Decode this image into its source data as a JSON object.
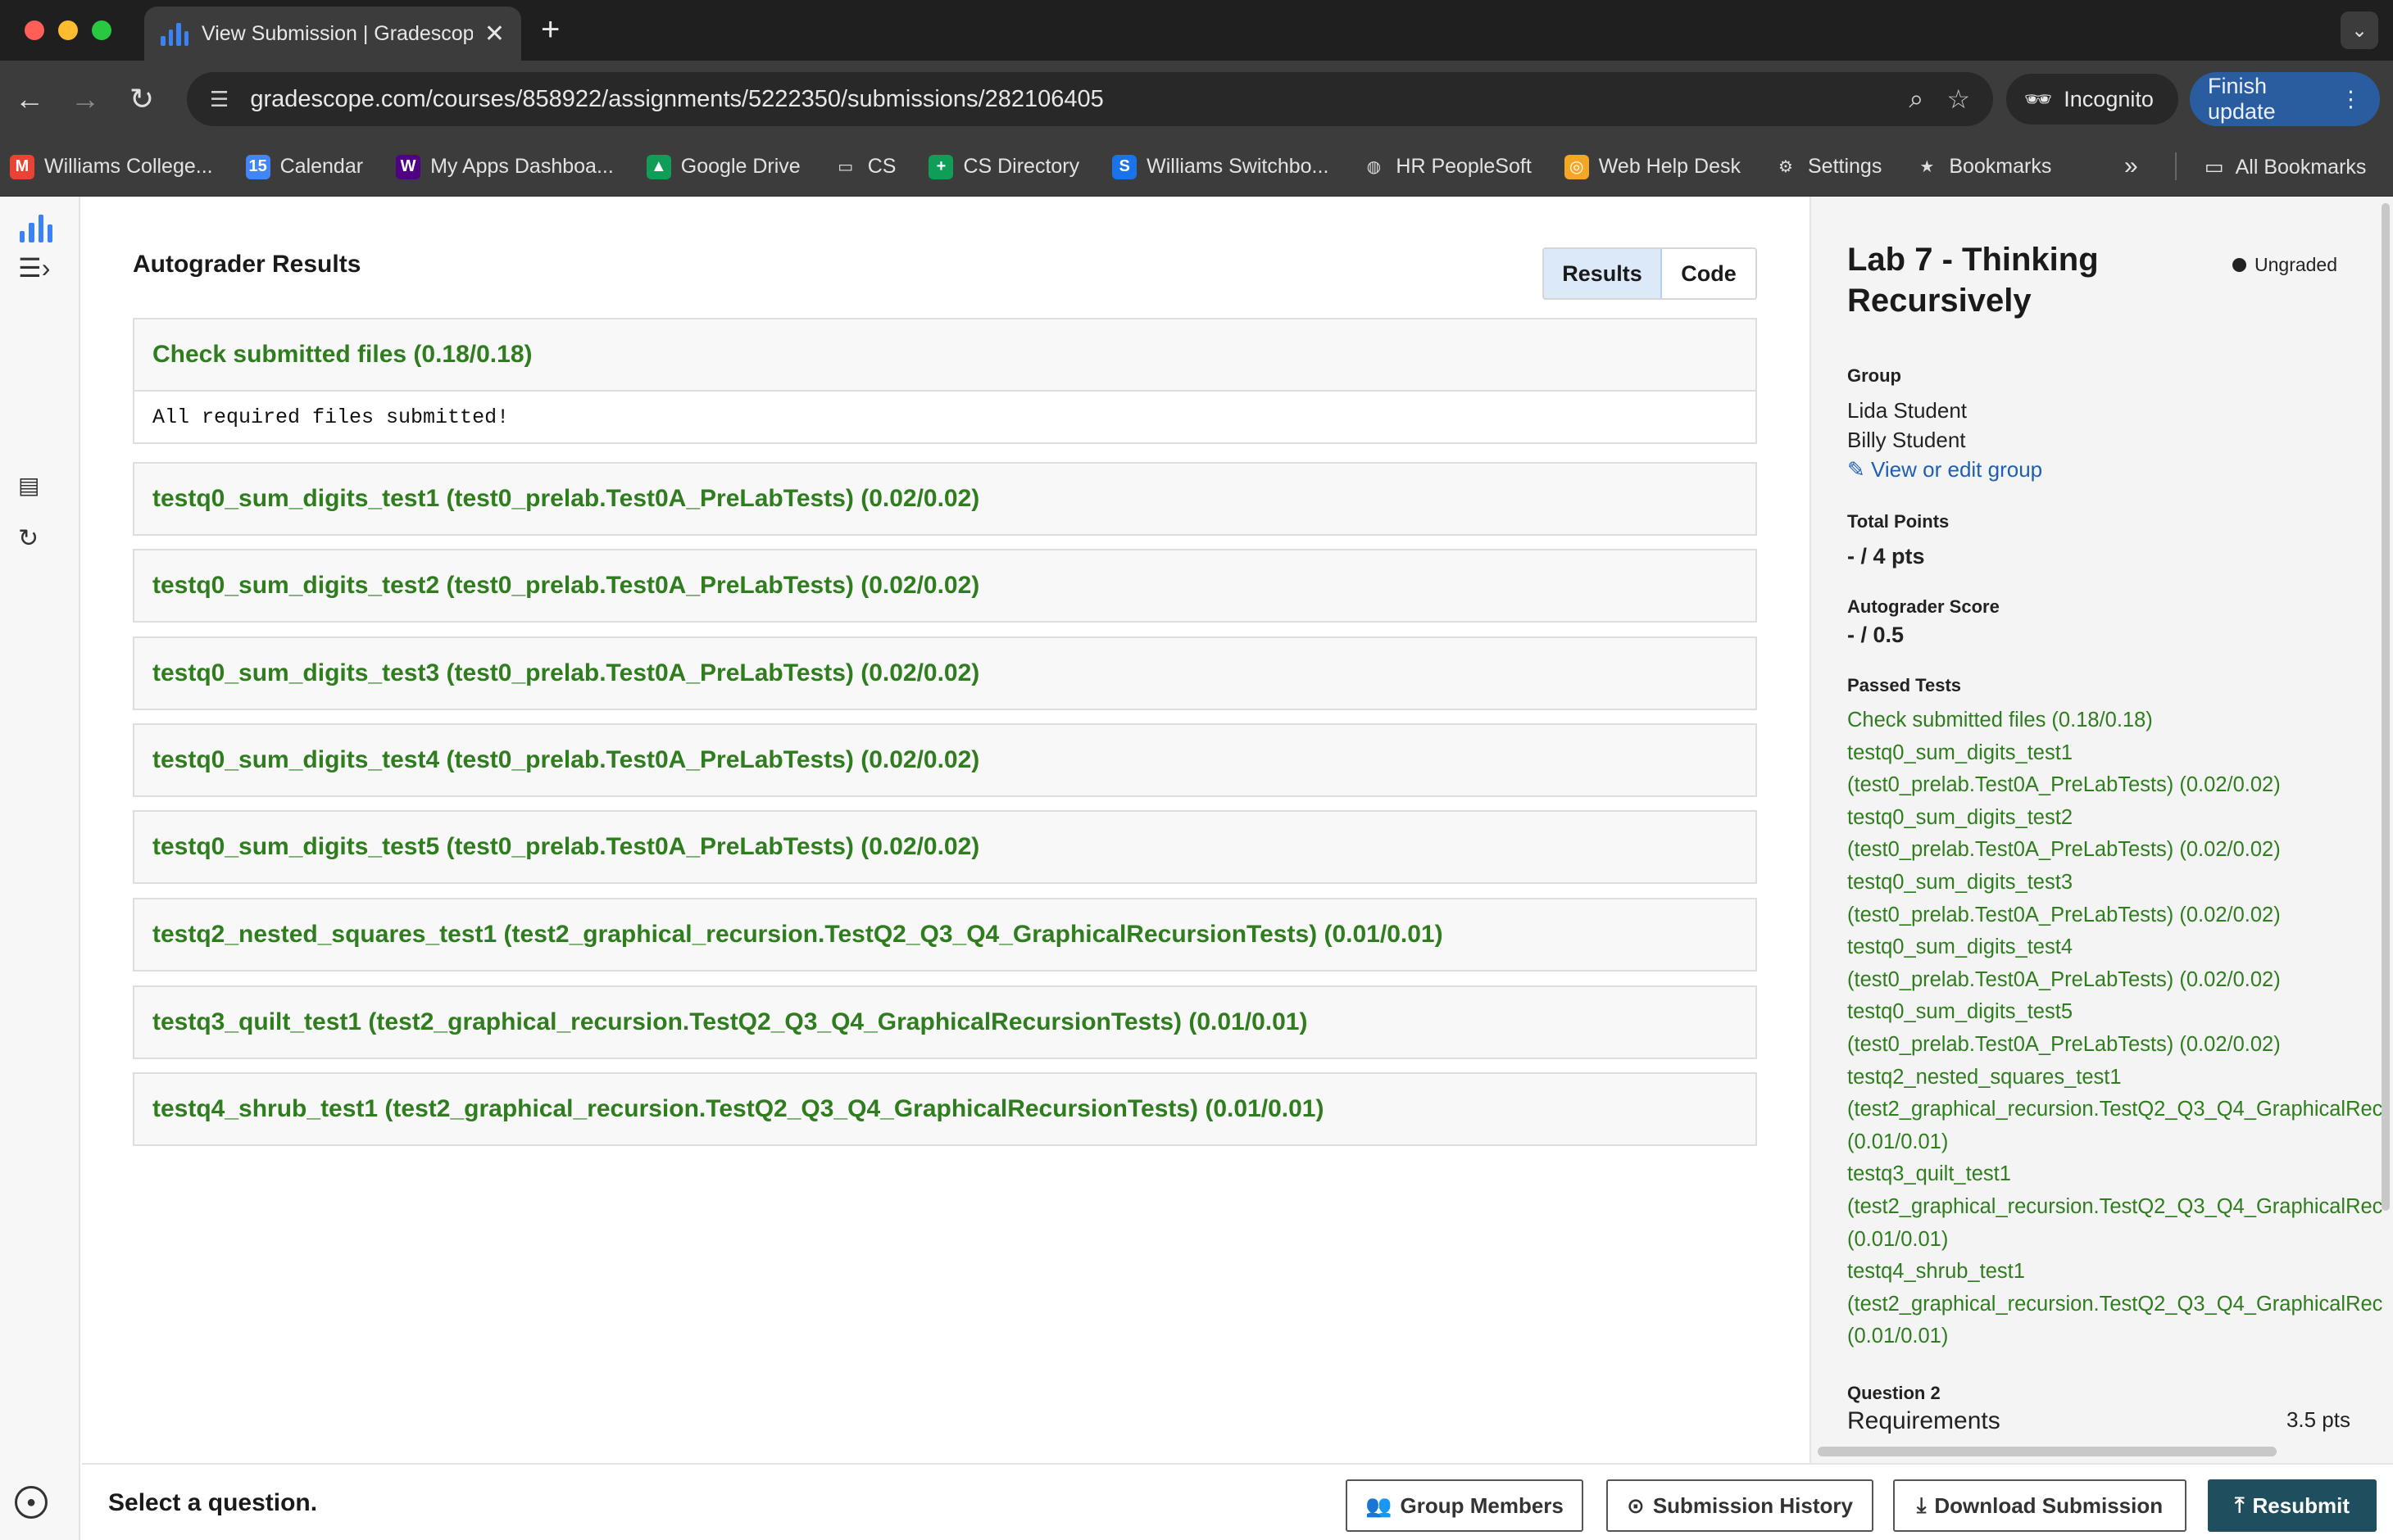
{
  "browser": {
    "tab_title": "View Submission | Gradescope",
    "tab_close": "✕",
    "new_tab": "+",
    "url": "gradescope.com/courses/858922/assignments/5222350/submissions/282106405",
    "incognito_label": "Incognito",
    "finish_update_label": "Finish update",
    "bookmarks": [
      {
        "label": "Williams College...",
        "icon": "gmail-icon",
        "color": "#ea4335"
      },
      {
        "label": "Calendar",
        "icon": "calendar-icon",
        "color": "#4285f4"
      },
      {
        "label": "My Apps Dashboa...",
        "icon": "williams-w-icon",
        "color": "#500082"
      },
      {
        "label": "Google Drive",
        "icon": "drive-icon",
        "color": "#0f9d58"
      },
      {
        "label": "CS",
        "icon": "folder-icon",
        "color": ""
      },
      {
        "label": "CS Directory",
        "icon": "sheets-icon",
        "color": "#0f9d58"
      },
      {
        "label": "Williams Switchbo...",
        "icon": "switchboard-icon",
        "color": "#1a73e8"
      },
      {
        "label": "HR PeopleSoft",
        "icon": "globe-icon",
        "color": ""
      },
      {
        "label": "Web Help Desk",
        "icon": "lifebuoy-icon",
        "color": "#f5a623"
      },
      {
        "label": "Settings",
        "icon": "gear-icon",
        "color": ""
      },
      {
        "label": "Bookmarks",
        "icon": "star-icon",
        "color": ""
      }
    ],
    "all_bookmarks_label": "All Bookmarks"
  },
  "main": {
    "title": "Autograder Results",
    "tabs": {
      "results": "Results",
      "code": "Code"
    },
    "tests": [
      {
        "name": "Check submitted files (0.18/0.18)",
        "output": "All required files submitted!"
      },
      {
        "name": "testq0_sum_digits_test1 (test0_prelab.Test0A_PreLabTests) (0.02/0.02)"
      },
      {
        "name": "testq0_sum_digits_test2 (test0_prelab.Test0A_PreLabTests) (0.02/0.02)"
      },
      {
        "name": "testq0_sum_digits_test3 (test0_prelab.Test0A_PreLabTests) (0.02/0.02)"
      },
      {
        "name": "testq0_sum_digits_test4 (test0_prelab.Test0A_PreLabTests) (0.02/0.02)"
      },
      {
        "name": "testq0_sum_digits_test5 (test0_prelab.Test0A_PreLabTests) (0.02/0.02)"
      },
      {
        "name": "testq2_nested_squares_test1 (test2_graphical_recursion.TestQ2_Q3_Q4_GraphicalRecursionTests) (0.01/0.01)"
      },
      {
        "name": "testq3_quilt_test1 (test2_graphical_recursion.TestQ2_Q3_Q4_GraphicalRecursionTests) (0.01/0.01)"
      },
      {
        "name": "testq4_shrub_test1 (test2_graphical_recursion.TestQ2_Q3_Q4_GraphicalRecursionTests) (0.01/0.01)"
      }
    ]
  },
  "sidebar": {
    "assignment_title": "Lab 7 - Thinking Recursively",
    "status": "Ungraded",
    "group_label": "Group",
    "members": [
      "Lida Student",
      "Billy Student"
    ],
    "edit_group_link": "View or edit group",
    "total_points_label": "Total Points",
    "total_points_value": "- / 4 pts",
    "autograder_label": "Autograder Score",
    "autograder_value": "- / 0.5",
    "passed_label": "Passed Tests",
    "passed_lines": [
      "Check submitted files (0.18/0.18)",
      "testq0_sum_digits_test1",
      "(test0_prelab.Test0A_PreLabTests) (0.02/0.02)",
      "testq0_sum_digits_test2",
      "(test0_prelab.Test0A_PreLabTests) (0.02/0.02)",
      "testq0_sum_digits_test3",
      "(test0_prelab.Test0A_PreLabTests) (0.02/0.02)",
      "testq0_sum_digits_test4",
      "(test0_prelab.Test0A_PreLabTests) (0.02/0.02)",
      "testq0_sum_digits_test5",
      "(test0_prelab.Test0A_PreLabTests) (0.02/0.02)",
      "testq2_nested_squares_test1",
      "(test2_graphical_recursion.TestQ2_Q3_Q4_GraphicalRec",
      "(0.01/0.01)",
      "testq3_quilt_test1",
      "(test2_graphical_recursion.TestQ2_Q3_Q4_GraphicalRec",
      "(0.01/0.01)",
      "testq4_shrub_test1",
      "(test2_graphical_recursion.TestQ2_Q3_Q4_GraphicalRec",
      "(0.01/0.01)"
    ],
    "question_label": "Question 2",
    "question_name": "Requirements",
    "question_points": "3.5 pts"
  },
  "footer": {
    "message": "Select a question.",
    "group_members": "Group Members",
    "submission_history": "Submission History",
    "download_submission": "Download Submission",
    "resubmit": "Resubmit"
  },
  "colors": {
    "pass_green": "#2f7d1f",
    "link_blue": "#1e5fb3",
    "primary_button": "#1f4e5f"
  }
}
